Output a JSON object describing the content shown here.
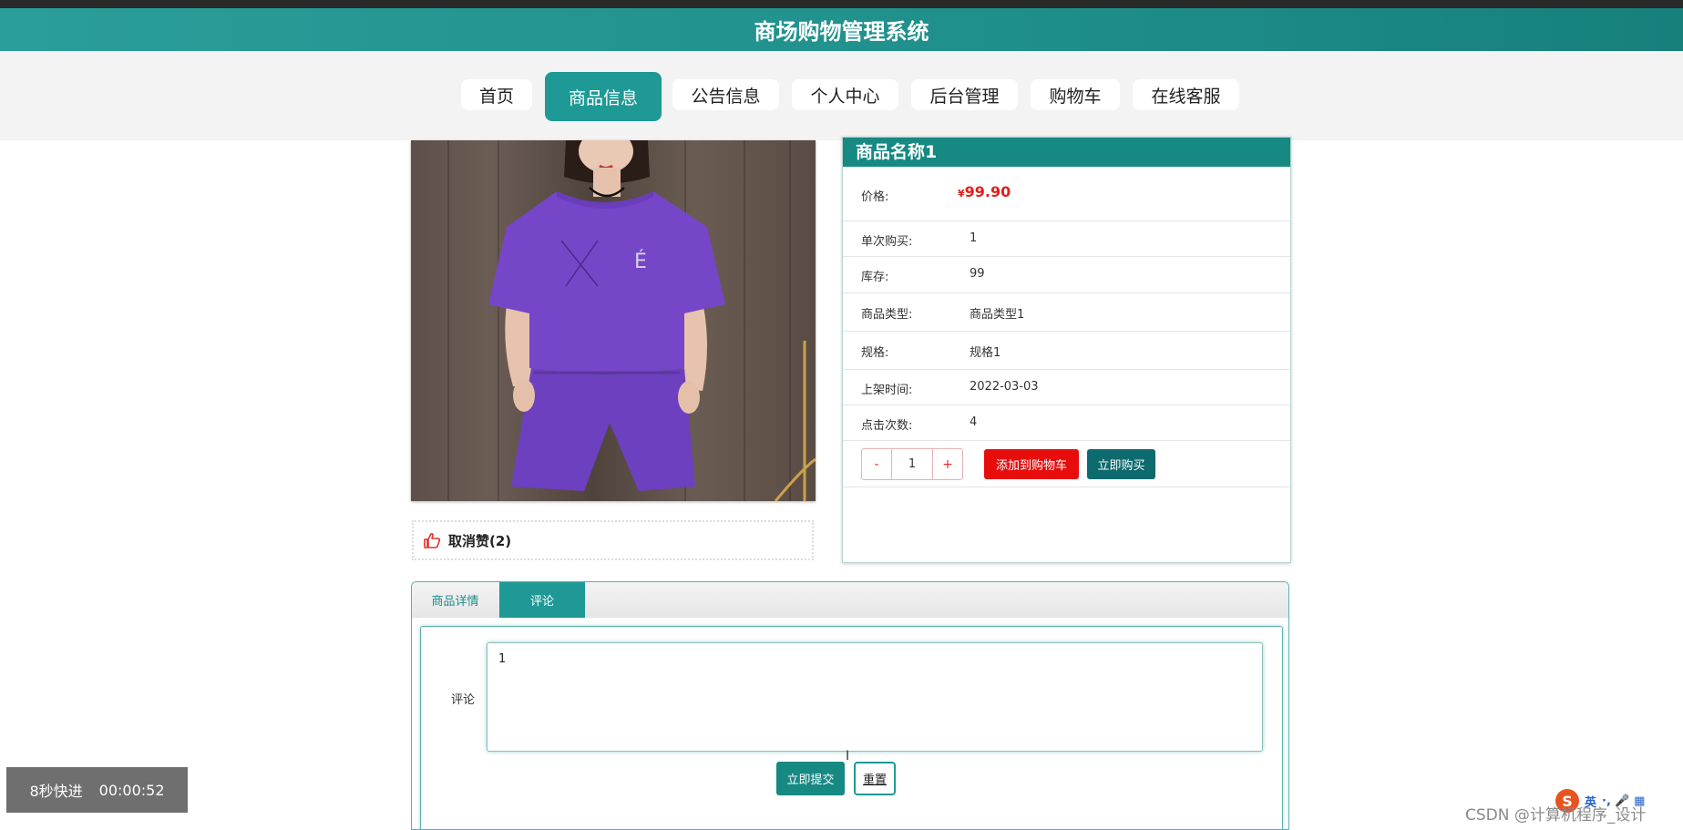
{
  "app": {
    "title": "商场购物管理系统"
  },
  "nav": {
    "items": [
      {
        "label": "首页"
      },
      {
        "label": "商品信息",
        "active": true
      },
      {
        "label": "公告信息"
      },
      {
        "label": "个人中心"
      },
      {
        "label": "后台管理"
      },
      {
        "label": "购物车"
      },
      {
        "label": "在线客服"
      }
    ]
  },
  "product": {
    "name": "商品名称1",
    "price_label": "价格:",
    "currency": "¥",
    "price": "99.90",
    "fields": [
      {
        "label": "单次购买:",
        "value": "1"
      },
      {
        "label": "库存:",
        "value": "99"
      },
      {
        "label": "商品类型:",
        "value": "商品类型1"
      },
      {
        "label": "规格:",
        "value": "规格1"
      },
      {
        "label": "上架时间:",
        "value": "2022-03-03"
      },
      {
        "label": "点击次数:",
        "value": "4"
      }
    ],
    "quantity": {
      "minus": "-",
      "value": "1",
      "plus": "+"
    },
    "add_to_cart": "添加到购物车",
    "buy_now": "立即购买",
    "like_label": "取消赞(2)"
  },
  "tabs": [
    {
      "label": "商品详情",
      "active": false
    },
    {
      "label": "评论",
      "active": true
    }
  ],
  "comment": {
    "label": "评论",
    "value": "1",
    "submit": "立即提交",
    "reset": "重置"
  },
  "overlay": {
    "speed": "8秒快进",
    "time": "00:00:52"
  },
  "watermark": "CSDN @计算机程序_设计",
  "ime": {
    "logo": "S",
    "lang": "英",
    "icons": "·, 🎤 ▦"
  },
  "colors": {
    "brand": "#1f9995",
    "price": "#e0201c",
    "cart": "#e80d0d",
    "buy": "#0d6a6e"
  }
}
